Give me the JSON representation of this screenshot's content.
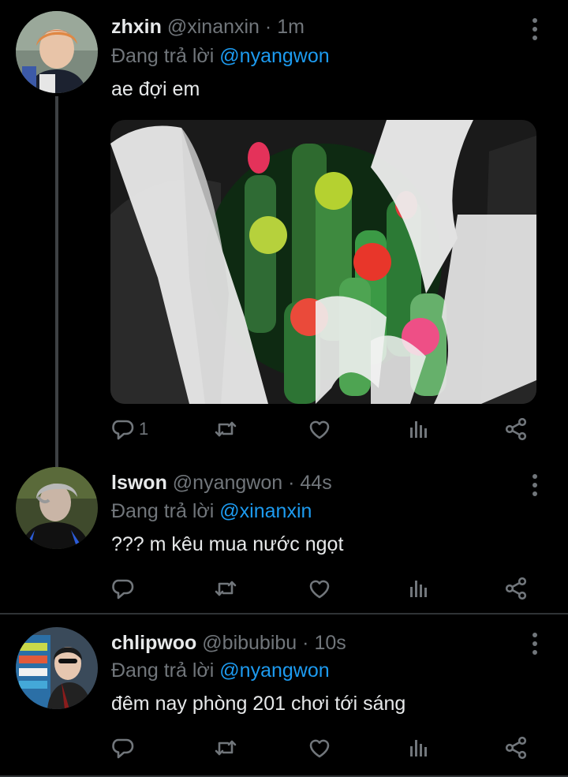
{
  "tweets": [
    {
      "name": "zhxin",
      "handle": "@xinanxin",
      "time": "1m",
      "replying_prefix": "Đang trả lời",
      "replying_to": "@nyangwon",
      "text": "ae đợi em",
      "reply_count": "1"
    },
    {
      "name": "lswon",
      "handle": "@nyangwon",
      "time": "44s",
      "replying_prefix": "Đang trả lời",
      "replying_to": "@xinanxin",
      "text": "??? m kêu mua nước ngọt",
      "reply_count": ""
    },
    {
      "name": "chlipwoo",
      "handle": "@bibubibu",
      "time": "10s",
      "replying_prefix": "Đang trả lời",
      "replying_to": "@nyangwon",
      "text": "đêm nay phòng 201 chơi tới sáng",
      "reply_count": ""
    }
  ],
  "separator": "·",
  "icons": {
    "reply": "reply-icon",
    "retweet": "retweet-icon",
    "like": "heart-icon",
    "views": "analytics-icon",
    "share": "share-icon",
    "more": "more-vertical-icon"
  },
  "colors": {
    "background": "#000000",
    "text": "#e7e9ea",
    "muted": "#71767b",
    "accent": "#1d9bf0",
    "divider": "#2f3336"
  }
}
